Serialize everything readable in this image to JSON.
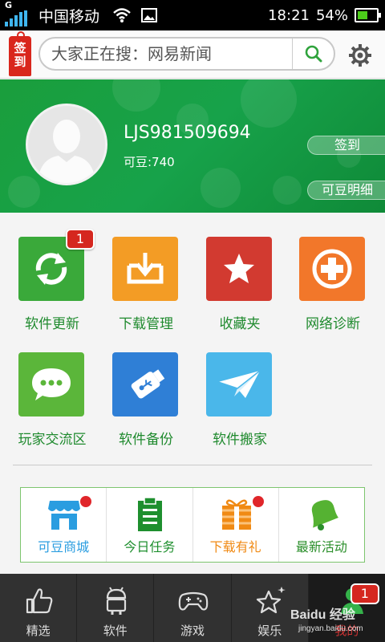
{
  "status_bar": {
    "network_type": "G",
    "carrier": "中国移动",
    "time": "18:21",
    "battery_percent": "54%",
    "battery_level": 0.54,
    "icons": [
      "signal-icon",
      "wifi-icon",
      "image-icon",
      "battery-icon"
    ]
  },
  "header": {
    "sign_tag": "签到",
    "search_placeholder": "大家正在搜：网易新闻",
    "search_icon": "search-icon",
    "settings_icon": "gear-icon"
  },
  "profile": {
    "username": "LJS981509694",
    "points": "可豆:740",
    "checkin_label": "签到",
    "points_detail_label": "可豆明细"
  },
  "grid": {
    "items": [
      {
        "label": "软件更新",
        "icon": "refresh-icon",
        "color": "#3aa93a",
        "badge": "1"
      },
      {
        "label": "下载管理",
        "icon": "download-tray-icon",
        "color": "#f39c25"
      },
      {
        "label": "收藏夹",
        "icon": "star-icon",
        "color": "#d23a30"
      },
      {
        "label": "网络诊断",
        "icon": "medical-cross-icon",
        "color": "#f2772a"
      },
      {
        "label": "玩家交流区",
        "icon": "chat-bubble-icon",
        "color": "#5bb63a"
      },
      {
        "label": "软件备份",
        "icon": "usb-drive-icon",
        "color": "#2f7fd6"
      },
      {
        "label": "软件搬家",
        "icon": "paper-plane-icon",
        "color": "#4ab7ea"
      }
    ]
  },
  "quick": {
    "items": [
      {
        "label": "可豆商城",
        "icon": "shop-icon",
        "color": "#2a9de0",
        "dot": true
      },
      {
        "label": "今日任务",
        "icon": "clipboard-icon",
        "color": "#1e8f2e",
        "dot": false
      },
      {
        "label": "下载有礼",
        "icon": "gift-icon",
        "color": "#f08a14",
        "dot": true
      },
      {
        "label": "最新活动",
        "icon": "bell-icon",
        "color": "#2b8f2b",
        "dot": false
      }
    ]
  },
  "tabs": [
    {
      "label": "精选",
      "icon": "thumbs-up-icon"
    },
    {
      "label": "软件",
      "icon": "android-icon"
    },
    {
      "label": "游戏",
      "icon": "gamepad-icon"
    },
    {
      "label": "娱乐",
      "icon": "star-sparkle-icon"
    },
    {
      "label": "我的",
      "icon": "user-icon",
      "badge": "1"
    }
  ],
  "watermark": {
    "brand": "Baidu 经验",
    "url": "jingyan.baidu.com"
  }
}
